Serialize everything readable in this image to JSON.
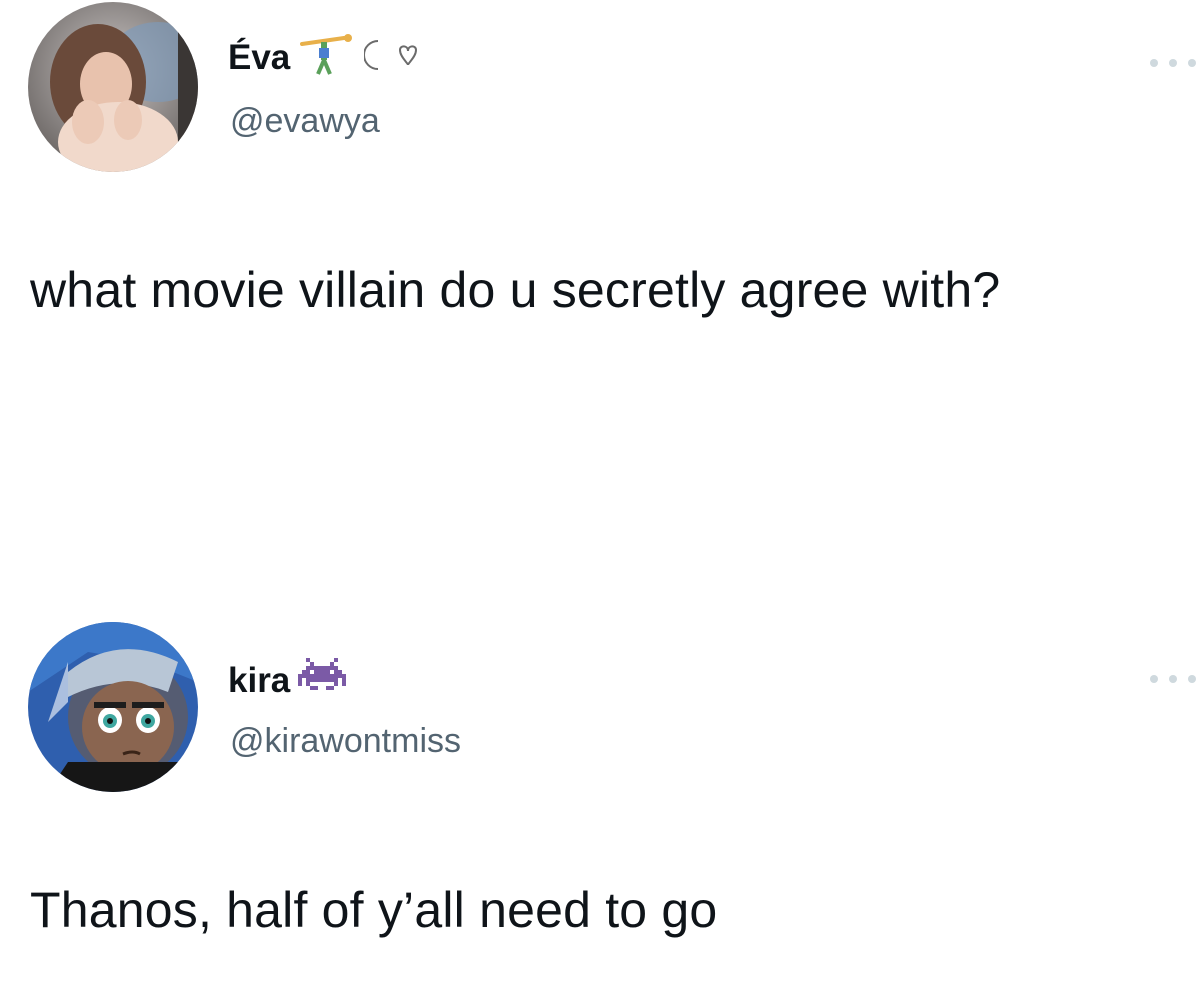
{
  "tweets": [
    {
      "display_name": "Éva",
      "name_emojis": [
        "cartwheel-emoji",
        "moon-heart-emoji"
      ],
      "handle": "@evawya",
      "text": "what movie villain do u secretly agree with?",
      "more_icon": "more-dots-icon"
    },
    {
      "display_name": "kira",
      "name_emojis": [
        "space-invader-emoji"
      ],
      "handle": "@kirawontmiss",
      "text": "Thanos, half of y’all need to go",
      "more_icon": "more-dots-icon"
    }
  ],
  "colors": {
    "text": "#0f1419",
    "secondary": "#536471",
    "background": "#ffffff",
    "dots": "#cfd9de"
  }
}
